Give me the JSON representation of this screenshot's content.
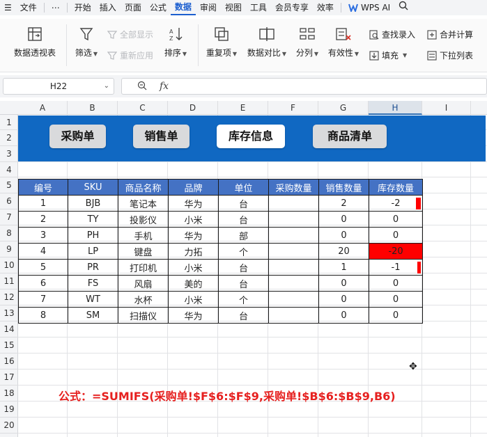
{
  "menubar": {
    "items": [
      "文件",
      "⋯",
      "开始",
      "插入",
      "页面",
      "公式",
      "数据",
      "审阅",
      "视图",
      "工具",
      "会员专享",
      "效率"
    ],
    "active": "数据",
    "wps_ai": "WPS AI"
  },
  "ribbon": {
    "pivot": "数据透视表",
    "filter": "筛选",
    "show_all": "全部显示",
    "reapply": "重新应用",
    "sort": "排序",
    "duplicates": "重复项",
    "compare": "数据对比",
    "split": "分列",
    "validity": "有效性",
    "find_entry": "查找录入",
    "fill": "填充",
    "consolidate": "合并计算",
    "dropdown_list": "下拉列表"
  },
  "formula_bar": {
    "name_box": "H22",
    "fx": "fx",
    "content": ""
  },
  "grid": {
    "columns": [
      "A",
      "B",
      "C",
      "D",
      "E",
      "F",
      "G",
      "H",
      "I"
    ],
    "selected_column": "H",
    "rows": [
      "1",
      "2",
      "3",
      "4",
      "5",
      "6",
      "7",
      "8",
      "9",
      "10",
      "11",
      "12",
      "13",
      "14",
      "15",
      "16",
      "17",
      "18",
      "19",
      "20"
    ]
  },
  "nav_buttons": [
    "采购单",
    "销售单",
    "库存信息",
    "商品清单"
  ],
  "nav_active": "库存信息",
  "table": {
    "headers": [
      "编号",
      "SKU",
      "商品名称",
      "品牌",
      "单位",
      "采购数量",
      "销售数量",
      "库存数量"
    ],
    "rows": [
      [
        "1",
        "BJB",
        "笔记本",
        "华为",
        "台",
        "",
        "2",
        "-2"
      ],
      [
        "2",
        "TY",
        "投影仪",
        "小米",
        "台",
        "",
        "0",
        "0"
      ],
      [
        "3",
        "PH",
        "手机",
        "华为",
        "部",
        "",
        "0",
        "0"
      ],
      [
        "4",
        "LP",
        "键盘",
        "力拓",
        "个",
        "",
        "20",
        "-20"
      ],
      [
        "5",
        "PR",
        "打印机",
        "小米",
        "台",
        "",
        "1",
        "-1"
      ],
      [
        "6",
        "FS",
        "风扇",
        "美的",
        "台",
        "",
        "0",
        "0"
      ],
      [
        "7",
        "WT",
        "水杯",
        "小米",
        "个",
        "",
        "0",
        "0"
      ],
      [
        "8",
        "SM",
        "扫描仪",
        "华为",
        "台",
        "",
        "0",
        "0"
      ]
    ],
    "stock_bar_fraction": [
      0.1,
      0,
      0,
      1.0,
      0.05,
      0,
      0,
      0
    ]
  },
  "formula_note": "公式：=SUMIFS(采购单!$F$6:$F$9,采购单!$B$6:$B$9,B6)",
  "colors": {
    "banner": "#1068c2",
    "header_fill": "#4472c4",
    "negative_bar": "#ff0000",
    "note_text": "#e6201f",
    "accent": "#1b5ecf"
  },
  "icons": {
    "pivot": "pivot-table-icon",
    "filter": "funnel-icon",
    "sort": "sort-icon",
    "duplicates": "duplicate-icon",
    "compare": "compare-icon",
    "split": "split-columns-icon",
    "validity": "validity-icon",
    "find": "search-icon",
    "fill": "fill-down-icon",
    "consolidate": "consolidate-icon",
    "dropdown": "dropdown-list-icon",
    "zoom": "zoom-icon"
  }
}
